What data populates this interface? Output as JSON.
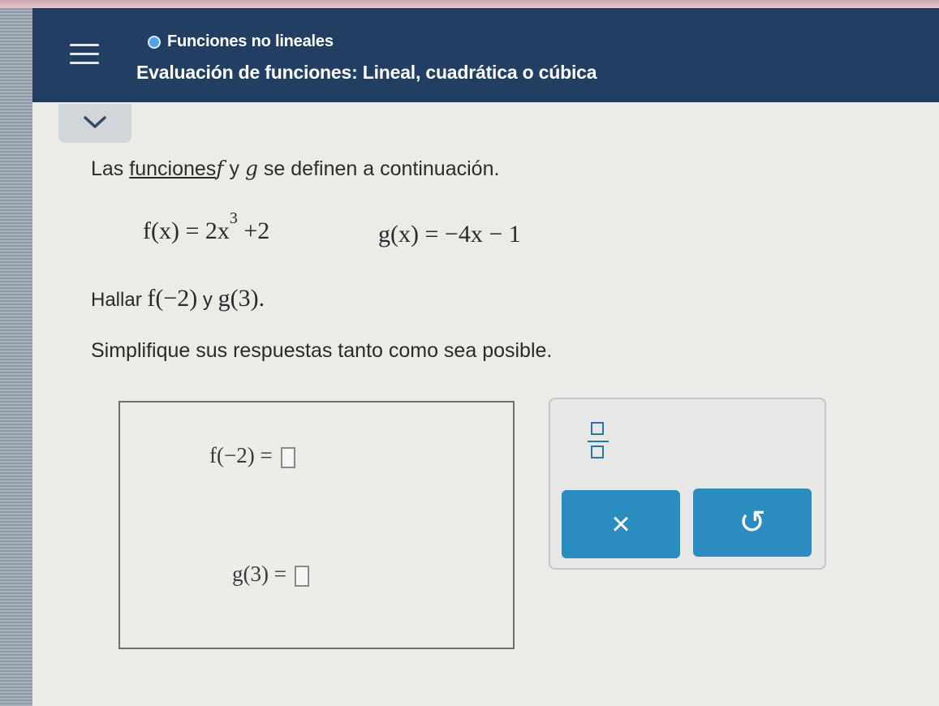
{
  "header": {
    "topic": "Funciones no lineales",
    "lesson_title": "Evaluación de funciones: Lineal, cuadrática o cúbica"
  },
  "problem": {
    "intro_before": "Las ",
    "intro_link": "funciones",
    "intro_f": "f",
    "intro_y": " y ",
    "intro_g": "g",
    "intro_after": " se definen a continuación.",
    "f_def": "f(x) = 2x",
    "f_exp": "3",
    "f_tail": " +2",
    "g_def": "g(x) = −4x − 1",
    "find_label": "Hallar ",
    "find_f": "f(−2)",
    "find_y": " y ",
    "find_g": "g(3).",
    "simplify": "Simplifique sus respuestas tanto como sea posible."
  },
  "answers": {
    "f_label": "f(−2) =",
    "g_label": "g(3) ="
  },
  "tools": {
    "clear_symbol": "×",
    "undo_symbol": "↺"
  },
  "colors": {
    "header_bg": "#223f63",
    "button_bg": "#2a8cbf",
    "status_dot": "#4fa3e8"
  },
  "icons": [
    "menu-icon",
    "status-dot-icon",
    "chevron-down-icon",
    "fraction-icon",
    "close-icon",
    "undo-icon"
  ]
}
